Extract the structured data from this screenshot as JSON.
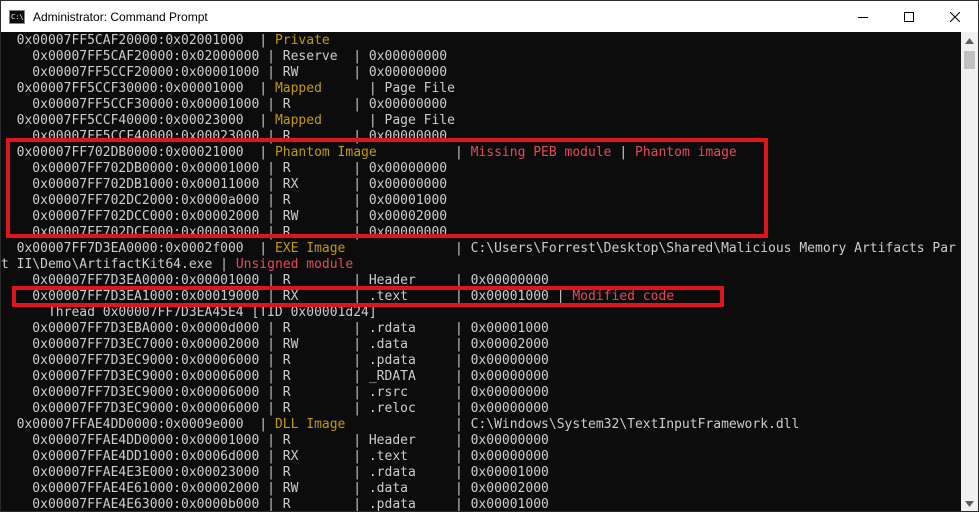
{
  "window": {
    "title": "Administrator: Command Prompt",
    "icon_label": "C:\\.",
    "icons": {
      "app": "command-prompt-icon",
      "minimize": "minimize-icon",
      "maximize": "maximize-icon",
      "close": "close-icon",
      "scroll_up": "scroll-up-arrow-icon",
      "scroll_down": "scroll-down-arrow-icon"
    }
  },
  "colors": {
    "background": "#0c0c0c",
    "text": "#cccccc",
    "yellow": "#c19c00",
    "red": "#e74856",
    "highlight_box": "#e0151b"
  },
  "console": {
    "lines": [
      {
        "segments": [
          {
            "t": "  0x00007FF5CAF20000:0x02001000  | "
          },
          {
            "t": "Private",
            "c": "y"
          }
        ]
      },
      {
        "segments": [
          {
            "t": "    0x00007FF5CAF20000:0x02000000 | Reserve  | 0x00000000"
          }
        ]
      },
      {
        "segments": [
          {
            "t": "    0x00007FF5CCF20000:0x00001000 | RW       | 0x00000000"
          }
        ]
      },
      {
        "segments": [
          {
            "t": "  0x00007FF5CCF30000:0x00001000  | "
          },
          {
            "t": "Mapped",
            "c": "y"
          },
          {
            "t": "      | Page File"
          }
        ]
      },
      {
        "segments": [
          {
            "t": "    0x00007FF5CCF30000:0x00001000 | R        | 0x00000000"
          }
        ]
      },
      {
        "segments": [
          {
            "t": "  0x00007FF5CCF40000:0x00023000  | "
          },
          {
            "t": "Mapped",
            "c": "y"
          },
          {
            "t": "      | Page File"
          }
        ]
      },
      {
        "segments": [
          {
            "t": "    0x00007FF5CCF40000:0x00023000 | R        | 0x00000000"
          }
        ]
      },
      {
        "segments": [
          {
            "t": "  0x00007FF702DB0000:0x00021000  | "
          },
          {
            "t": "Phantom Image",
            "c": "y"
          },
          {
            "t": "          | "
          },
          {
            "t": "Missing PEB module",
            "c": "r"
          },
          {
            "t": " | "
          },
          {
            "t": "Phantom image",
            "c": "r"
          }
        ]
      },
      {
        "segments": [
          {
            "t": "    0x00007FF702DB0000:0x00001000 | R        | 0x00000000"
          }
        ]
      },
      {
        "segments": [
          {
            "t": "    0x00007FF702DB1000:0x00011000 | RX       | 0x00000000"
          }
        ]
      },
      {
        "segments": [
          {
            "t": "    0x00007FF702DC2000:0x0000a000 | R        | 0x00001000"
          }
        ]
      },
      {
        "segments": [
          {
            "t": "    0x00007FF702DCC000:0x00002000 | RW       | 0x00002000"
          }
        ]
      },
      {
        "segments": [
          {
            "t": "    0x00007FF702DCE000:0x00003000 | R        | 0x00000000"
          }
        ]
      },
      {
        "segments": [
          {
            "t": "  0x00007FF7D3EA0000:0x0002f000  | "
          },
          {
            "t": "EXE Image",
            "c": "y"
          },
          {
            "t": "              | C:\\Users\\Forrest\\Desktop\\Shared\\Malicious Memory Artifacts Par"
          }
        ]
      },
      {
        "segments": [
          {
            "t": "t II\\Demo\\ArtifactKit64.exe | "
          },
          {
            "t": "Unsigned module",
            "c": "r"
          }
        ]
      },
      {
        "segments": [
          {
            "t": "    0x00007FF7D3EA0000:0x00001000 | R        | Header     | 0x00000000"
          }
        ]
      },
      {
        "segments": [
          {
            "t": "    0x00007FF7D3EA1000:0x00019000 | RX       | .text      | 0x00001000 | "
          },
          {
            "t": "Modified code",
            "c": "r"
          }
        ]
      },
      {
        "segments": [
          {
            "t": "      Thread 0x00007FF7D3EA45E4 [TID 0x00001d24]"
          }
        ]
      },
      {
        "segments": [
          {
            "t": "    0x00007FF7D3EBA000:0x0000d000 | R        | .rdata     | 0x00001000"
          }
        ]
      },
      {
        "segments": [
          {
            "t": "    0x00007FF7D3EC7000:0x00002000 | RW       | .data      | 0x00002000"
          }
        ]
      },
      {
        "segments": [
          {
            "t": "    0x00007FF7D3EC9000:0x00006000 | R        | .pdata     | 0x00000000"
          }
        ]
      },
      {
        "segments": [
          {
            "t": "    0x00007FF7D3EC9000:0x00006000 | R        | _RDATA     | 0x00000000"
          }
        ]
      },
      {
        "segments": [
          {
            "t": "    0x00007FF7D3EC9000:0x00006000 | R        | .rsrc      | 0x00000000"
          }
        ]
      },
      {
        "segments": [
          {
            "t": "    0x00007FF7D3EC9000:0x00006000 | R        | .reloc     | 0x00000000"
          }
        ]
      },
      {
        "segments": [
          {
            "t": "  0x00007FFAE4DD0000:0x0009e000  | "
          },
          {
            "t": "DLL Image",
            "c": "y"
          },
          {
            "t": "              | C:\\Windows\\System32\\TextInputFramework.dll"
          }
        ]
      },
      {
        "segments": [
          {
            "t": "    0x00007FFAE4DD0000:0x00001000 | R        | Header     | 0x00000000"
          }
        ]
      },
      {
        "segments": [
          {
            "t": "    0x00007FFAE4DD1000:0x0006d000 | RX       | .text      | 0x00000000"
          }
        ]
      },
      {
        "segments": [
          {
            "t": "    0x00007FFAE4E3E000:0x00023000 | R        | .rdata     | 0x00001000"
          }
        ]
      },
      {
        "segments": [
          {
            "t": "    0x00007FFAE4E61000:0x00002000 | RW       | .data      | 0x00002000"
          }
        ]
      },
      {
        "segments": [
          {
            "t": "    0x00007FFAE4E63000:0x0000b000 | R        | .pdata     | 0x00001000"
          }
        ]
      }
    ]
  }
}
